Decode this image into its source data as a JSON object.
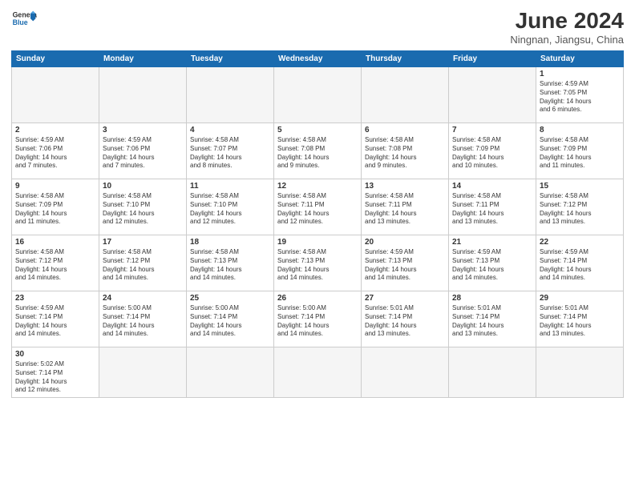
{
  "header": {
    "title": "June 2024",
    "location": "Ningnan, Jiangsu, China",
    "logo_line1": "General",
    "logo_line2": "Blue"
  },
  "weekdays": [
    "Sunday",
    "Monday",
    "Tuesday",
    "Wednesday",
    "Thursday",
    "Friday",
    "Saturday"
  ],
  "weeks": [
    [
      {
        "day": "",
        "info": ""
      },
      {
        "day": "",
        "info": ""
      },
      {
        "day": "",
        "info": ""
      },
      {
        "day": "",
        "info": ""
      },
      {
        "day": "",
        "info": ""
      },
      {
        "day": "",
        "info": ""
      },
      {
        "day": "1",
        "info": "Sunrise: 4:59 AM\nSunset: 7:05 PM\nDaylight: 14 hours\nand 6 minutes."
      }
    ],
    [
      {
        "day": "2",
        "info": "Sunrise: 4:59 AM\nSunset: 7:06 PM\nDaylight: 14 hours\nand 7 minutes."
      },
      {
        "day": "3",
        "info": "Sunrise: 4:59 AM\nSunset: 7:06 PM\nDaylight: 14 hours\nand 7 minutes."
      },
      {
        "day": "4",
        "info": "Sunrise: 4:58 AM\nSunset: 7:07 PM\nDaylight: 14 hours\nand 8 minutes."
      },
      {
        "day": "5",
        "info": "Sunrise: 4:58 AM\nSunset: 7:08 PM\nDaylight: 14 hours\nand 9 minutes."
      },
      {
        "day": "6",
        "info": "Sunrise: 4:58 AM\nSunset: 7:08 PM\nDaylight: 14 hours\nand 9 minutes."
      },
      {
        "day": "7",
        "info": "Sunrise: 4:58 AM\nSunset: 7:09 PM\nDaylight: 14 hours\nand 10 minutes."
      },
      {
        "day": "8",
        "info": "Sunrise: 4:58 AM\nSunset: 7:09 PM\nDaylight: 14 hours\nand 11 minutes."
      }
    ],
    [
      {
        "day": "9",
        "info": "Sunrise: 4:58 AM\nSunset: 7:09 PM\nDaylight: 14 hours\nand 11 minutes."
      },
      {
        "day": "10",
        "info": "Sunrise: 4:58 AM\nSunset: 7:10 PM\nDaylight: 14 hours\nand 12 minutes."
      },
      {
        "day": "11",
        "info": "Sunrise: 4:58 AM\nSunset: 7:10 PM\nDaylight: 14 hours\nand 12 minutes."
      },
      {
        "day": "12",
        "info": "Sunrise: 4:58 AM\nSunset: 7:11 PM\nDaylight: 14 hours\nand 12 minutes."
      },
      {
        "day": "13",
        "info": "Sunrise: 4:58 AM\nSunset: 7:11 PM\nDaylight: 14 hours\nand 13 minutes."
      },
      {
        "day": "14",
        "info": "Sunrise: 4:58 AM\nSunset: 7:11 PM\nDaylight: 14 hours\nand 13 minutes."
      },
      {
        "day": "15",
        "info": "Sunrise: 4:58 AM\nSunset: 7:12 PM\nDaylight: 14 hours\nand 13 minutes."
      }
    ],
    [
      {
        "day": "16",
        "info": "Sunrise: 4:58 AM\nSunset: 7:12 PM\nDaylight: 14 hours\nand 14 minutes."
      },
      {
        "day": "17",
        "info": "Sunrise: 4:58 AM\nSunset: 7:12 PM\nDaylight: 14 hours\nand 14 minutes."
      },
      {
        "day": "18",
        "info": "Sunrise: 4:58 AM\nSunset: 7:13 PM\nDaylight: 14 hours\nand 14 minutes."
      },
      {
        "day": "19",
        "info": "Sunrise: 4:58 AM\nSunset: 7:13 PM\nDaylight: 14 hours\nand 14 minutes."
      },
      {
        "day": "20",
        "info": "Sunrise: 4:59 AM\nSunset: 7:13 PM\nDaylight: 14 hours\nand 14 minutes."
      },
      {
        "day": "21",
        "info": "Sunrise: 4:59 AM\nSunset: 7:13 PM\nDaylight: 14 hours\nand 14 minutes."
      },
      {
        "day": "22",
        "info": "Sunrise: 4:59 AM\nSunset: 7:14 PM\nDaylight: 14 hours\nand 14 minutes."
      }
    ],
    [
      {
        "day": "23",
        "info": "Sunrise: 4:59 AM\nSunset: 7:14 PM\nDaylight: 14 hours\nand 14 minutes."
      },
      {
        "day": "24",
        "info": "Sunrise: 5:00 AM\nSunset: 7:14 PM\nDaylight: 14 hours\nand 14 minutes."
      },
      {
        "day": "25",
        "info": "Sunrise: 5:00 AM\nSunset: 7:14 PM\nDaylight: 14 hours\nand 14 minutes."
      },
      {
        "day": "26",
        "info": "Sunrise: 5:00 AM\nSunset: 7:14 PM\nDaylight: 14 hours\nand 14 minutes."
      },
      {
        "day": "27",
        "info": "Sunrise: 5:01 AM\nSunset: 7:14 PM\nDaylight: 14 hours\nand 13 minutes."
      },
      {
        "day": "28",
        "info": "Sunrise: 5:01 AM\nSunset: 7:14 PM\nDaylight: 14 hours\nand 13 minutes."
      },
      {
        "day": "29",
        "info": "Sunrise: 5:01 AM\nSunset: 7:14 PM\nDaylight: 14 hours\nand 13 minutes."
      }
    ],
    [
      {
        "day": "30",
        "info": "Sunrise: 5:02 AM\nSunset: 7:14 PM\nDaylight: 14 hours\nand 12 minutes."
      },
      {
        "day": "",
        "info": ""
      },
      {
        "day": "",
        "info": ""
      },
      {
        "day": "",
        "info": ""
      },
      {
        "day": "",
        "info": ""
      },
      {
        "day": "",
        "info": ""
      },
      {
        "day": "",
        "info": ""
      }
    ]
  ]
}
